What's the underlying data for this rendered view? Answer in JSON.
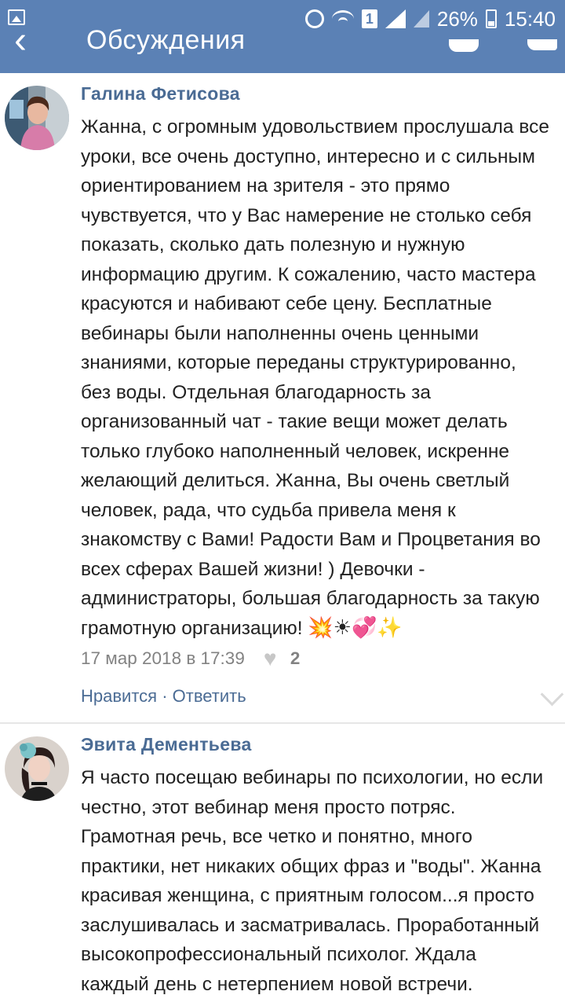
{
  "status_bar": {
    "battery": "26%",
    "time": "15:40",
    "sim_label": "1"
  },
  "header": {
    "title": "Обсуждения"
  },
  "comments": [
    {
      "author": "Галина Фетисова",
      "text": "Жанна, с огромным удовольствием прослушала все\nуроки, все очень доступно, интересно и с сильным\nориентированием на зрителя - это прямо\nчувствуется, что у Вас намерение не столько себя\nпоказать, сколько дать полезную и нужную\nинформацию другим. К сожалению, часто мастера\nкрасуются и набивают себе цену. Бесплатные\nвебинары были наполненны очень ценными\nзнаниями, которые переданы структурированно,\nбез воды. Отдельная благодарность за\nорганизованный чат - такие вещи может делать\nтолько глубоко наполненный человек, искренне\nжелающий делиться. Жанна, Вы очень светлый\nчеловек, рада, что судьба привела меня к\nзнакомству с Вами! Радости Вам и Процветания во\nвсех сферах Вашей жизни! ) Девочки -\nадминистраторы, большая благодарность за такую\nграмотную организацию! ",
      "emojis": "💥☀💞✨",
      "date": "17 мар 2018 в 17:39",
      "likes": "2",
      "actions": "Нравится · Ответить"
    },
    {
      "author": "Эвита Дементьева",
      "text": "Я часто посещаю вебинары по психологии, но если\nчестно, этот вебинар меня просто потряс.\nГрамотная речь, все четко и понятно, много\nпрактики, нет никаких общих фраз и \"воды\". Жанна\nкрасивая женщина, с приятным голосом...я просто\nзаслушивалась и засматривалась. Проработанный\nвысокопрофессиональный психолог. Ждала\nкаждый день с нетерпением новой встречи."
    }
  ],
  "colors": {
    "header_bg": "#5b81b5",
    "author": "#4a6b94",
    "text": "#222222",
    "meta": "#828282"
  }
}
